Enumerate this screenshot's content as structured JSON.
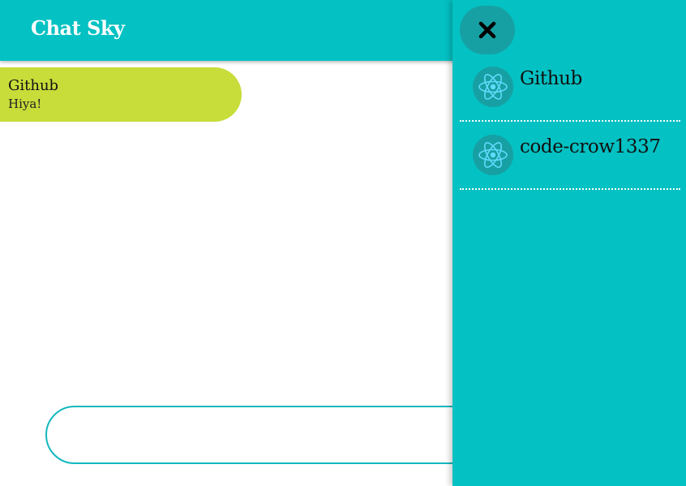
{
  "app": {
    "title": "Chat Sky"
  },
  "messages": [
    {
      "author": "Github",
      "text": "Hiya!"
    }
  ],
  "composer": {
    "value": "",
    "placeholder": ""
  },
  "drawer": {
    "close_icon": "close-icon",
    "users": [
      {
        "name": "Github",
        "avatar_icon": "react-atom-icon"
      },
      {
        "name": "code-crow1337",
        "avatar_icon": "react-atom-icon"
      }
    ]
  },
  "colors": {
    "primary": "#04c1c3",
    "primary_dark": "#17a0a3",
    "message_bubble": "#c8dc3a",
    "react_blue": "#61dafb",
    "composer_border": "#14b8be"
  }
}
